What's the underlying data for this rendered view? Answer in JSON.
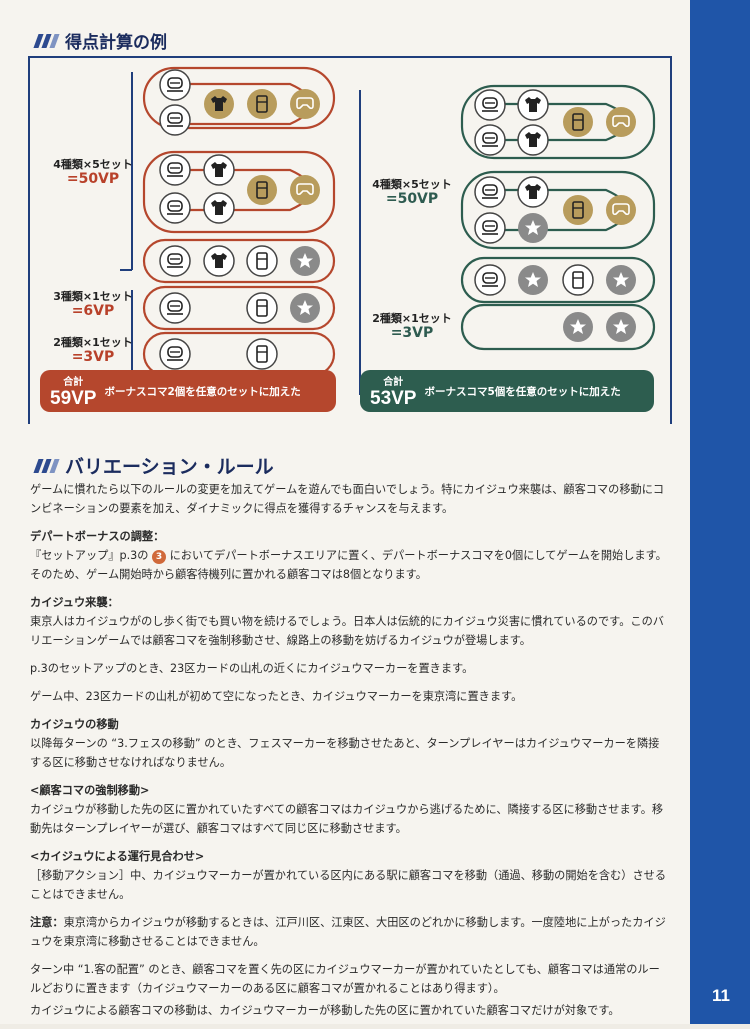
{
  "scoring": {
    "title": "得点計算の例",
    "left": {
      "label_set4": "4種類×5セット",
      "label_set4_vp": "=50VP",
      "label_set3": "3種類×1セット",
      "label_set3_vp": "=6VP",
      "label_set2": "2種類×1セット",
      "label_set2_vp": "=3VP",
      "total_caption": "合計",
      "total_value": "59VP",
      "total_note": "ボーナスコマ2個を任意のセットに加えた",
      "accent": "#b5472d"
    },
    "right": {
      "label_set4": "4種類×5セット",
      "label_set4_vp": "=50VP",
      "label_set2": "2種類×1セット",
      "label_set2_vp": "=3VP",
      "total_caption": "合計",
      "total_value": "53VP",
      "total_note": "ボーナスコマ5個を任意のセットに加えた",
      "accent": "#2d5d4f"
    },
    "piece_icons": [
      "train-icon",
      "shirt-icon",
      "fridge-icon",
      "gamepad-icon",
      "star-icon"
    ]
  },
  "variation": {
    "title": "バリエーション・ルール",
    "intro": "ゲームに慣れたら以下のルールの変更を加えてゲームを遊んでも面白いでしょう。特にカイジュウ来襲は、顧客コマの移動にコンビネーションの要素を加え、ダイナミックに得点を獲得するチャンスを与えます。",
    "s1_title": "デパートボーナスの調整：",
    "s1_pre": "『セットアップ』p.3の",
    "s1_num": "3",
    "s1_post": "においてデパートボーナスエリアに置く、デパートボーナスコマを0個にしてゲームを開始します。そのため、ゲーム開始時から顧客待機列に置かれる顧客コマは8個となります。",
    "s2_title": "カイジュウ来襲：",
    "s2_p1": "東京人はカイジュウがのし歩く街でも買い物を続けるでしょう。日本人は伝統的にカイジュウ災害に慣れているのです。このバリエーションゲームでは顧客コマを強制移動させ、線路上の移動を妨げるカイジュウが登場します。",
    "s2_p2": "p.3のセットアップのとき、23区カードの山札の近くにカイジュウマーカーを置きます。",
    "s2_p3": "ゲーム中、23区カードの山札が初めて空になったとき、カイジュウマーカーを東京湾に置きます。",
    "s3_title": "カイジュウの移動",
    "s3_p1": "以降毎ターンの “3.フェスの移動” のとき、フェスマーカーを移動させたあと、ターンプレイヤーはカイジュウマーカーを隣接する区に移動させなければなりません。",
    "s4_title": "<顧客コマの強制移動>",
    "s4_p1": "カイジュウが移動した先の区に置かれていたすべての顧客コマはカイジュウから逃げるために、隣接する区に移動させます。移動先はターンプレイヤーが選び、顧客コマはすべて同じ区に移動させます。",
    "s5_title": "<カイジュウによる運行見合わせ>",
    "s5_p1": "［移動アクション］中、カイジュウマーカーが置かれている区内にある駅に顧客コマを移動（通過、移動の開始を含む）させることはできません。",
    "s6_label": "注意：",
    "s6_p1": "東京湾からカイジュウが移動するときは、江戸川区、江東区、大田区のどれかに移動します。一度陸地に上がったカイジュウを東京湾に移動させることはできません。",
    "s7_p1": "ターン中 “1.客の配置” のとき、顧客コマを置く先の区にカイジュウマーカーが置かれていたとしても、顧客コマは通常のルールどおりに置きます（カイジュウマーカーのある区に顧客コマが置かれることはあり得ます）。",
    "s7_p2": "カイジュウによる顧客コマの移動は、カイジュウマーカーが移動した先の区に置かれていた顧客コマだけが対象です。"
  },
  "page_number": "11"
}
